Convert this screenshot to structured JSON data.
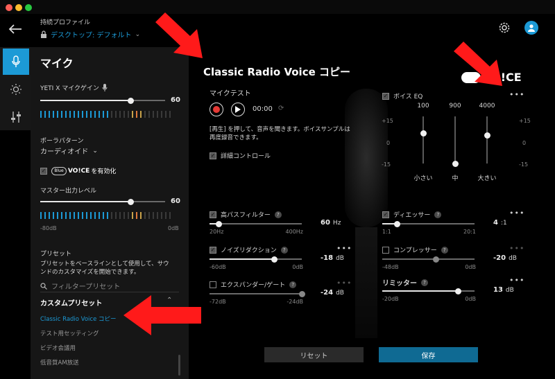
{
  "header": {
    "profile_label": "持続プロファイル",
    "profile_value": "デスクトップ: デフォルト"
  },
  "panel": {
    "title": "マイク",
    "gain_label": "YETI X マイクゲイン",
    "gain_value": "60",
    "gain_level": 0.72,
    "pattern_label": "ポーラパターン",
    "pattern_value": "カーディオイド",
    "voice_enable_label": "を有効化",
    "voice_logo_text": "VO!CE",
    "master_label": "マスター出力レベル",
    "master_value": "60",
    "master_level": 0.72,
    "master_min": "-80dB",
    "master_max": "0dB",
    "presets_title": "プリセット",
    "presets_desc_1": "プリセットをベースラインとして使用して、サウ",
    "presets_desc_2": "ンドのカスタマイズを開始できます。",
    "filter_placeholder": "フィルタープリセット",
    "custom_title": "カスタムプリセット",
    "preset_items": [
      "Classic Radio Voice コピー",
      "テスト用セッティング",
      "ビデオ会議用",
      "低音質AM放送"
    ]
  },
  "main": {
    "title": "Classic Radio Voice コピー",
    "logo_text": "VO!CE",
    "mic_test_label": "マイクテスト",
    "time": "00:00",
    "hint_1": "[再生] を押して、音声を聞きます。ボイスサンプルは",
    "hint_2": "再度録音できます。",
    "detail_label": "詳細コントロール",
    "eq": {
      "label": "ボイス EQ",
      "bands": [
        {
          "freq": "100",
          "label": "小さい",
          "gain": 4
        },
        {
          "freq": "900",
          "label": "中",
          "gain": -15
        },
        {
          "freq": "4000",
          "label": "大きい",
          "gain": 3
        }
      ],
      "scale_top": "+15",
      "scale_mid": "0",
      "scale_bottom": "-15"
    },
    "highpass": {
      "label": "高パスフィルター",
      "value": "60",
      "unit": "Hz",
      "min": "20Hz",
      "max": "400Hz",
      "level": 0.1
    },
    "deesser": {
      "label": "ディエッサー",
      "value": "4",
      "unit": ":1",
      "min": "1:1",
      "max": "20:1",
      "level": 0.16
    },
    "noise": {
      "label": "ノイズリダクション",
      "value": "-18",
      "unit": "dB",
      "min": "-60dB",
      "max": "0dB",
      "level": 0.7
    },
    "compressor": {
      "label": "コンプレッサー",
      "value": "-20",
      "unit": "dB",
      "min": "-48dB",
      "max": "0dB",
      "level": 0.58
    },
    "expander": {
      "label": "エクスパンダー/ゲート",
      "value": "-24",
      "unit": "dB",
      "min": "-72dB",
      "max": "-24dB",
      "level": 1.0
    },
    "limiter": {
      "label": "リミッター",
      "value": "13",
      "unit": "dB",
      "min": "-20dB",
      "max": "0dB",
      "level": 0.82
    },
    "reset_label": "リセット",
    "save_label": "保存"
  },
  "colors": {
    "accent": "#1c9ad6",
    "record": "#e53935",
    "save_bg": "#0f6a93",
    "arrow": "#ff1a1a"
  }
}
